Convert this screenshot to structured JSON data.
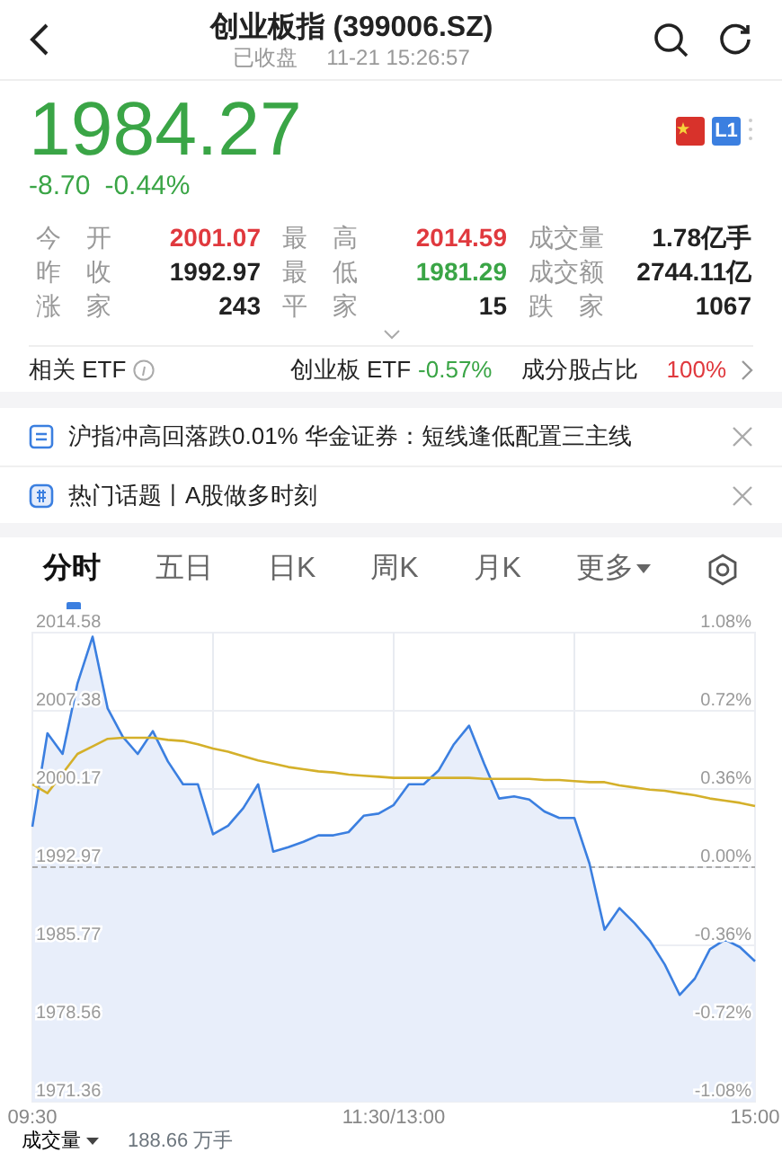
{
  "header": {
    "title": "创业板指 (399006.SZ)",
    "status": "已收盘",
    "time": "11-21 15:26:57"
  },
  "quote": {
    "price": "1984.27",
    "change": "-8.70",
    "change_pct": "-0.44%",
    "color": "#3aa546",
    "badge": "L1"
  },
  "stats": [
    [
      {
        "label": "今 开",
        "value": "2001.07",
        "color": "#e0393e"
      },
      {
        "label": "最 高",
        "value": "2014.59",
        "color": "#e0393e"
      },
      {
        "label": "成交量",
        "value": "1.78亿手",
        "color": "#222222"
      }
    ],
    [
      {
        "label": "昨 收",
        "value": "1992.97",
        "color": "#222222"
      },
      {
        "label": "最 低",
        "value": "1981.29",
        "color": "#3aa546"
      },
      {
        "label": "成交额",
        "value": "2744.11亿",
        "color": "#222222"
      }
    ],
    [
      {
        "label": "涨 家",
        "value": "243",
        "color": "#222222"
      },
      {
        "label": "平 家",
        "value": "15",
        "color": "#222222"
      },
      {
        "label": "跌 家",
        "value": "1067",
        "color": "#222222"
      }
    ]
  ],
  "etf": {
    "label": "相关 ETF",
    "fund": {
      "name": "创业板 ETF",
      "change": "-0.57%",
      "color": "#3aa546"
    },
    "ratio": {
      "label": "成分股占比",
      "value": "100%",
      "color": "#e0393e"
    }
  },
  "news": [
    {
      "kind": "article",
      "text": "沪指冲高回落跌0.01% 华金证券：短线逢低配置三主线"
    },
    {
      "kind": "topic",
      "text": "热门话题丨A股做多时刻"
    }
  ],
  "tabs": [
    {
      "label": "分时",
      "selected": true
    },
    {
      "label": "五日",
      "selected": false
    },
    {
      "label": "日K",
      "selected": false
    },
    {
      "label": "周K",
      "selected": false
    },
    {
      "label": "月K",
      "selected": false
    },
    {
      "label": "更多",
      "selected": false,
      "kind": "menu"
    }
  ],
  "chart": {
    "chart_data": {
      "type": "line",
      "categories": [
        "09:30",
        null,
        null,
        null,
        null,
        null,
        null,
        null,
        null,
        null,
        null,
        null,
        null,
        null,
        null,
        null,
        null,
        null,
        null,
        null,
        null,
        null,
        null,
        null,
        "11:30/13:00",
        null,
        null,
        null,
        null,
        null,
        null,
        null,
        null,
        null,
        null,
        null,
        null,
        null,
        null,
        null,
        null,
        null,
        null,
        null,
        null,
        null,
        null,
        null,
        "15:00"
      ],
      "series": [
        {
          "type": "area",
          "color": "#3b7fe0",
          "values": [
            1996.7,
            2005.3,
            2003.4,
            2009.9,
            2014.2,
            2007.6,
            2005.0,
            2003.4,
            2005.5,
            2002.7,
            2000.6,
            2000.6,
            1996.0,
            1996.8,
            1998.4,
            2000.6,
            1994.4,
            1994.8,
            1995.3,
            1995.9,
            1995.9,
            1996.2,
            1997.7,
            1997.9,
            1998.7,
            2000.6,
            2000.6,
            2001.9,
            2004.3,
            2006.0,
            2002.5,
            1999.3,
            1999.5,
            1999.2,
            1998.1,
            1997.5,
            1997.5,
            1993.3,
            1987.2,
            1989.2,
            1987.8,
            1986.2,
            1984.0,
            1981.2,
            1982.7,
            1985.4,
            1986.3,
            1985.6,
            1984.3
          ]
        },
        {
          "type": "line",
          "color": "#d4b02a",
          "values": [
            2000.6,
            1999.8,
            2001.6,
            2003.4,
            2004.1,
            2004.8,
            2004.9,
            2004.9,
            2004.9,
            2004.7,
            2004.6,
            2004.3,
            2003.9,
            2003.6,
            2003.2,
            2002.8,
            2002.5,
            2002.2,
            2002.0,
            2001.8,
            2001.7,
            2001.5,
            2001.4,
            2001.3,
            2001.2,
            2001.2,
            2001.2,
            2001.2,
            2001.2,
            2001.2,
            2001.1,
            2001.1,
            2001.1,
            2001.1,
            2001.0,
            2001.0,
            2000.9,
            2000.8,
            2000.8,
            2000.5,
            2000.3,
            2000.1,
            2000.0,
            1999.8,
            1999.6,
            1999.3,
            1999.1,
            1998.9,
            1998.6
          ]
        }
      ],
      "ylim": [
        1971.36,
        2014.58
      ],
      "grid": true,
      "ref_lines": [
        {
          "axis": "y",
          "value": 1992.97
        }
      ],
      "yticks": [
        {
          "value": 2014.58,
          "label": "2014.58"
        },
        {
          "value": 2007.38,
          "label": "2007.38"
        },
        {
          "value": 2000.17,
          "label": "2000.17"
        },
        {
          "value": 1992.97,
          "label": "1992.97"
        },
        {
          "value": 1985.77,
          "label": "1985.77"
        },
        {
          "value": 1978.56,
          "label": "1978.56"
        },
        {
          "value": 1971.36,
          "label": "1971.36"
        }
      ]
    },
    "right_axis_labels": [
      "1.08%",
      "0.72%",
      "0.36%",
      "0.00%",
      "-0.36%",
      "-0.72%",
      "-1.08%"
    ]
  },
  "volume": {
    "label": "成交量",
    "value": "188.66 万手"
  }
}
